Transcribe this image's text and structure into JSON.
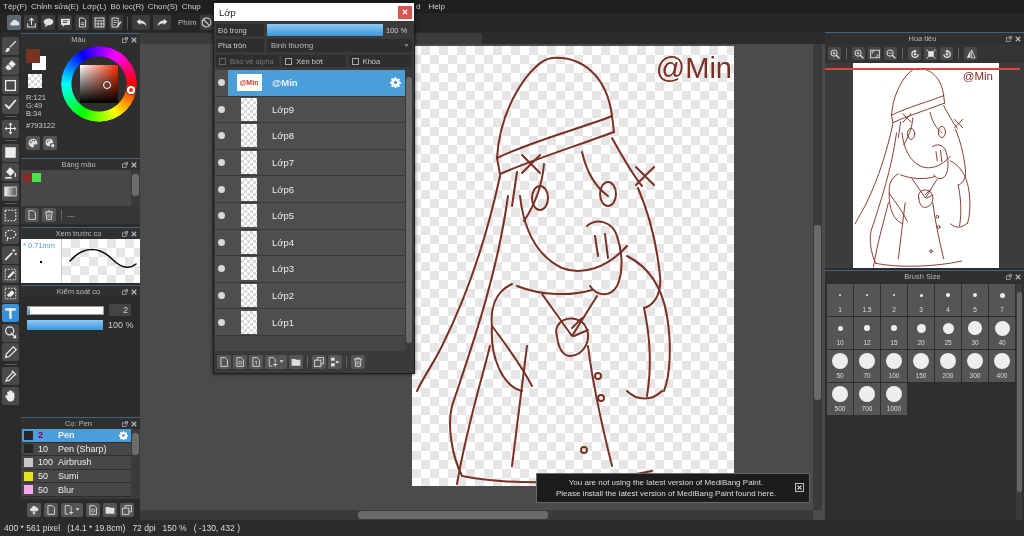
{
  "menu": {
    "items": [
      "Tệp(F)",
      "Chỉnh sửa(E)",
      "Lớp(L)",
      "Bộ lọc(R)",
      "Chọn(S)",
      "Chụp"
    ],
    "items_right": [
      "d",
      "Help"
    ]
  },
  "toolbar": {
    "buttons": [
      {
        "active": true
      },
      {
        "active": false
      },
      {
        "active": false
      },
      {
        "active": false
      },
      {
        "active": false
      },
      {
        "active": false
      },
      {
        "active": false
      }
    ],
    "label": "Phím"
  },
  "tools": [
    [
      {
        "selected": false
      },
      {
        "selected": false
      },
      {
        "selected": false
      },
      {
        "selected": false
      }
    ],
    [
      {
        "selected": false
      }
    ],
    [
      {
        "selected": false
      },
      {
        "selected": false
      },
      {
        "selected": false
      }
    ],
    [
      {
        "selected": false
      },
      {
        "selected": false
      },
      {
        "selected": false
      },
      {
        "selected": false
      },
      {
        "selected": false
      },
      {
        "selected": true
      },
      {
        "selected": false
      },
      {
        "selected": false
      }
    ],
    [
      {
        "selected": false
      },
      {
        "selected": false
      }
    ]
  ],
  "color_panel": {
    "title": "Màu",
    "swatches": [
      {
        "color": "#793122"
      },
      {
        "color": "#ffffff"
      }
    ],
    "rgb": [
      "R:121",
      "G:49",
      "B:34"
    ],
    "hex": "#793122"
  },
  "palette_panel": {
    "title": "Bảng màu",
    "swatches": [
      {
        "color": "#8b2a24"
      },
      {
        "color": "#4ee04e"
      }
    ],
    "name": "---"
  },
  "brush_preview": {
    "title": "Xem trước cọ",
    "size": "* 0.71mm"
  },
  "brush_control": {
    "title": "Kiểm soát cọ",
    "size": {
      "level": 0.02,
      "value": "2"
    },
    "opacity": {
      "level": 1,
      "value": "100 %"
    }
  },
  "brush_panel": {
    "title": "Cọ: Pen",
    "brushes": [
      {
        "color": "#262626",
        "size": "2",
        "name": "Pen",
        "selected": true
      },
      {
        "color": "#262626",
        "size": "10",
        "name": "Pen (Sharp)",
        "selected": false
      },
      {
        "color": "#c8c8c8",
        "size": "100",
        "name": "Airbrush",
        "selected": false
      },
      {
        "color": "#e6e01e",
        "size": "50",
        "name": "Sumi",
        "selected": false
      },
      {
        "color": "#f4a8f0",
        "size": "50",
        "name": "Blur",
        "selected": false
      }
    ]
  },
  "layer_window": {
    "title": "Lớp",
    "opacity": {
      "label": "Độ trong",
      "level": 1,
      "value": "100 %"
    },
    "blend": {
      "label": "Pha trộn",
      "value": "Bình thường"
    },
    "options": [
      {
        "label": "Bảo vệ alpha",
        "checked": false,
        "disabled": true
      },
      {
        "label": "Xén bớt",
        "checked": false,
        "disabled": false
      },
      {
        "label": "Khóa",
        "checked": false,
        "disabled": false
      }
    ],
    "layers": [
      {
        "name": "@Min",
        "thumb_text": "@Min",
        "visible": true,
        "selected": true
      },
      {
        "name": "Lớp9",
        "visible": true,
        "selected": false
      },
      {
        "name": "Lớp8",
        "visible": true,
        "selected": false
      },
      {
        "name": "Lớp7",
        "visible": true,
        "selected": false
      },
      {
        "name": "Lớp6",
        "visible": true,
        "selected": false
      },
      {
        "name": "Lớp5",
        "visible": true,
        "selected": false
      },
      {
        "name": "Lớp4",
        "visible": true,
        "selected": false
      },
      {
        "name": "Lớp3",
        "visible": true,
        "selected": false
      },
      {
        "name": "Lớp2",
        "visible": true,
        "selected": false
      },
      {
        "name": "Lớp1",
        "visible": true,
        "selected": false
      }
    ]
  },
  "document": {
    "canvas_text": "@Min"
  },
  "notification": {
    "lines": [
      "You are not using the latest version of MediBang Paint.",
      "Please install the latest version of MediBang Paint found here."
    ]
  },
  "navigator": {
    "title": "Hoa tiêu",
    "preview_text": "@Min"
  },
  "brush_size_panel": {
    "title": "Brush Size",
    "sizes": [
      "1",
      "1.5",
      "2",
      "3",
      "4",
      "5",
      "7",
      "10",
      "12",
      "15",
      "20",
      "25",
      "30",
      "40",
      "50",
      "70",
      "100",
      "150",
      "200",
      "300",
      "400",
      "500",
      "700",
      "1000"
    ]
  },
  "status_bar": {
    "items": [
      "400 * 561 pixel",
      "(14.1 * 19.8cm)",
      "72 dpi",
      "150 %",
      "( -130, 432 )"
    ]
  }
}
